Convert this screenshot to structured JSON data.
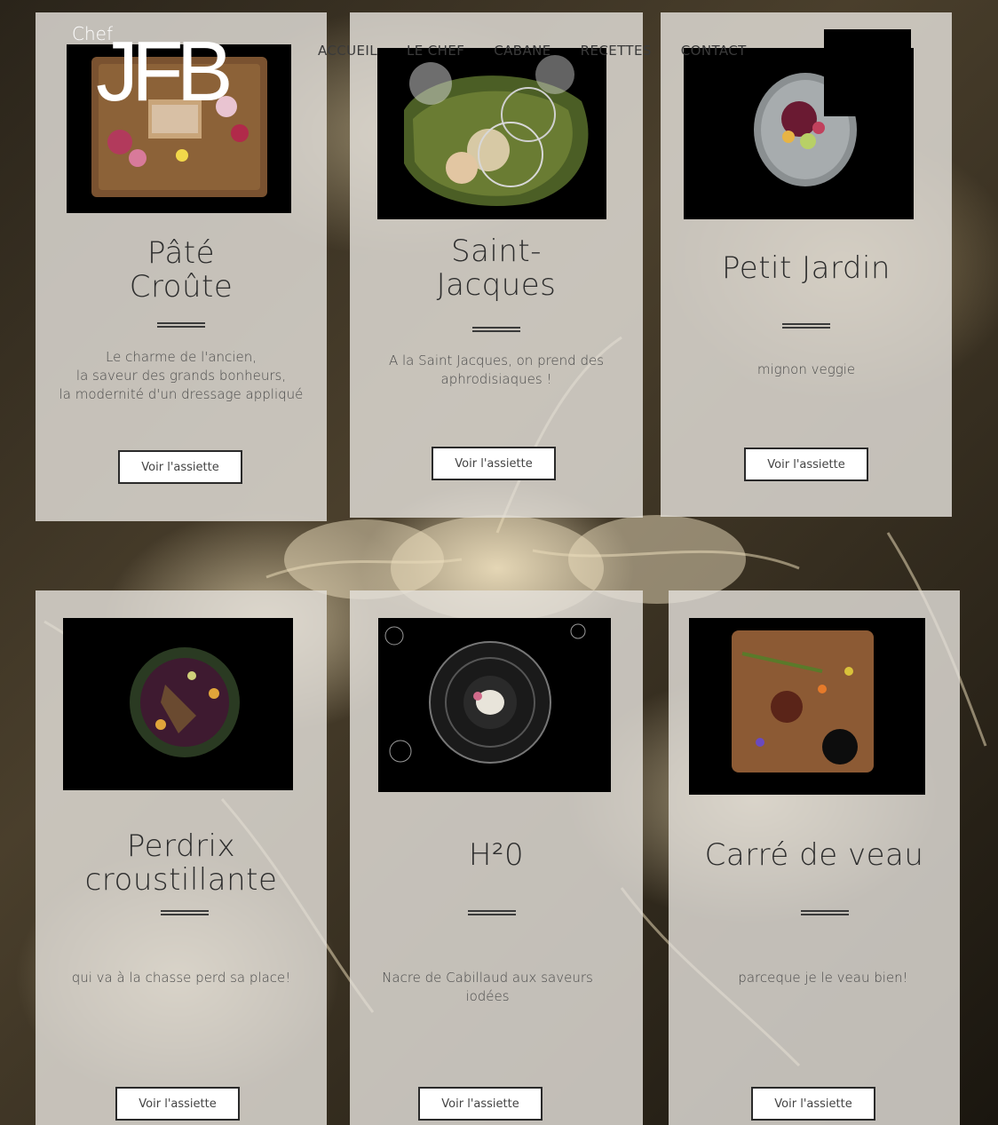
{
  "logo": {
    "chef": "Chef",
    "initials": "JFB"
  },
  "nav": {
    "items": [
      "ACCUEIL",
      "LE CHEF",
      "CABANE",
      "RECETTES",
      "CONTACT"
    ]
  },
  "cards": [
    {
      "title_line1": "Pâté",
      "title_line2": "Croûte",
      "desc_lines": [
        "Le charme de l'ancien,",
        "la saveur des grands bonheurs,",
        "la modernité d'un dressage appliqué"
      ],
      "button": "Voir l'assiette"
    },
    {
      "title_line1": "Saint-",
      "title_line2": "Jacques",
      "desc_lines": [
        "A la Saint Jacques, on prend des",
        "aphrodisiaques !"
      ],
      "button": "Voir l'assiette"
    },
    {
      "title_line1": "Petit Jardin",
      "desc_lines": [
        "mignon veggie"
      ],
      "button": "Voir l'assiette"
    },
    {
      "title_line1": "Perdrix",
      "title_line2": "croustillante",
      "desc_lines": [
        "qui va à la chasse perd sa place!"
      ],
      "button": "Voir l'assiette"
    },
    {
      "title_line1": "H²0",
      "desc_lines": [
        "Nacre de Cabillaud aux saveurs",
        "iodées"
      ],
      "button": "Voir l'assiette"
    },
    {
      "title_line1": "Carré de veau",
      "desc_lines": [
        "parceque je le veau bien!"
      ],
      "button": "Voir l'assiette"
    }
  ],
  "colors": {
    "card_bg": "#e4e1db",
    "text": "#2d2d2d",
    "photo_bg": "#000000"
  }
}
